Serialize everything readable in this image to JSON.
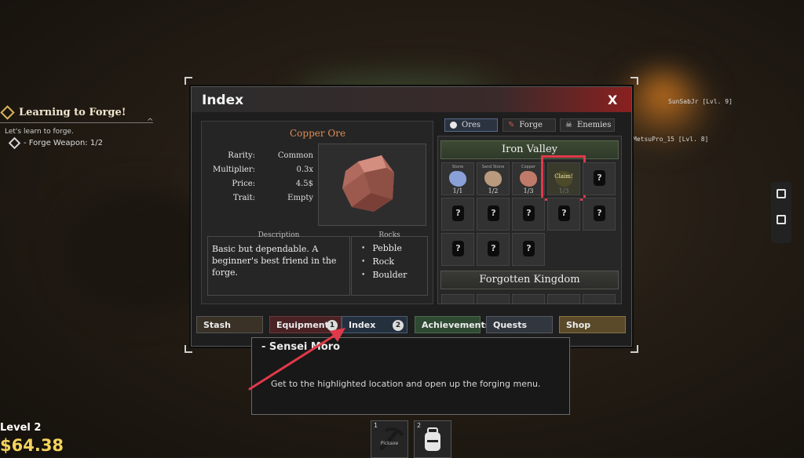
{
  "quest": {
    "title": "Learning to Forge!",
    "subtitle": "Let's learn to forge.",
    "task": "- Forge Weapon: 1/2",
    "caret": "^"
  },
  "player": {
    "level": "Level 2",
    "money": "$64.38"
  },
  "nameplates": [
    "SunSabJr [Lvl. 9]",
    "MetsuPro_15 [Lvl. 8]"
  ],
  "window": {
    "title": "Index",
    "close": "X",
    "item": {
      "name": "Copper Ore",
      "stats": [
        {
          "key": "Rarity:",
          "value": "Common"
        },
        {
          "key": "Multiplier:",
          "value": "0.3x"
        },
        {
          "key": "Price:",
          "value": "4.5$"
        },
        {
          "key": "Trait:",
          "value": "Empty"
        }
      ],
      "description_header": "Description",
      "description": "Basic but dependable. A beginner's best friend in the forge.",
      "rocks_header": "Rocks",
      "rocks": [
        "Pebble",
        "Rock",
        "Boulder"
      ]
    },
    "tabs": [
      {
        "label": "Ores",
        "icon": "ore-icon"
      },
      {
        "label": "Forge",
        "icon": "hammer-icon"
      },
      {
        "label": "Enemies",
        "icon": "skull-icon"
      }
    ],
    "zones": [
      "Iron Valley",
      "Forgotten Kingdom"
    ],
    "slots": [
      {
        "label": "Stone",
        "count": "1/1",
        "color": "#8aa0d8"
      },
      {
        "label": "Sand Stone",
        "count": "1/2",
        "color": "#b99a7e"
      },
      {
        "label": "Copper",
        "count": "1/3",
        "color": "#c07a6a"
      },
      {
        "label": "Claim!",
        "count": "1/3"
      }
    ],
    "unknown_mark": "?",
    "bottom_buttons": [
      {
        "label": "Stash"
      },
      {
        "label": "Equipments",
        "badge": "1"
      },
      {
        "label": "Index",
        "badge": "2"
      },
      {
        "label": "Achievements"
      },
      {
        "label": "Quests"
      },
      {
        "label": "Shop"
      }
    ]
  },
  "dialog": {
    "title": "- Sensei Moro",
    "text": "Get to the highlighted location and open up the forging menu."
  },
  "hotbar": [
    {
      "num": "1",
      "label": "Pickaxe"
    },
    {
      "num": "2",
      "label": ""
    }
  ],
  "colors": {
    "accent_red": "#e0394a",
    "money_gold": "#f3d35c",
    "ore_name": "#e08d55"
  }
}
